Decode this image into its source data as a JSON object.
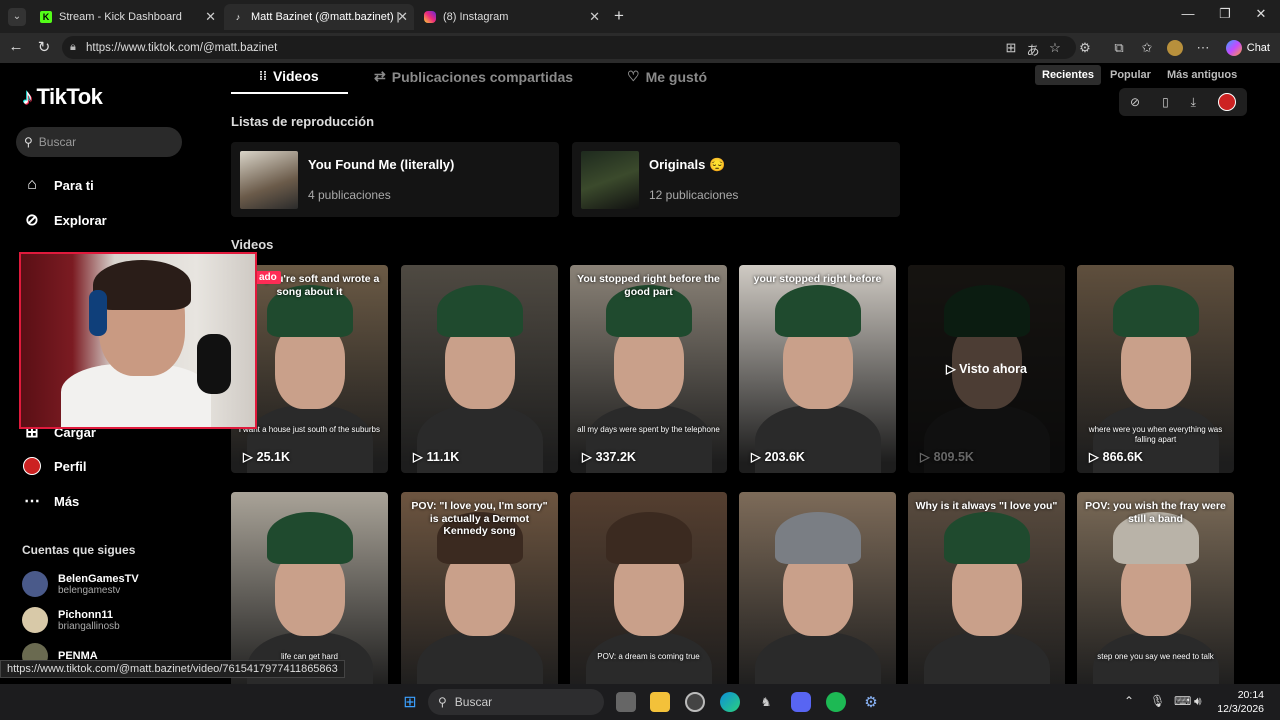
{
  "browser": {
    "tabs": [
      {
        "label": "Stream - Kick Dashboard",
        "icon": "kick-icon",
        "active": false
      },
      {
        "label": "Matt Bazinet (@matt.bazinet) | Tik",
        "icon": "tiktok-icon",
        "active": true
      },
      {
        "label": "(8) Instagram",
        "icon": "instagram-icon",
        "active": false
      }
    ],
    "url": "https://www.tiktok.com/@matt.bazinet",
    "chat_label": "Chat",
    "status_url": "https://www.tiktok.com/@matt.bazinet/video/7615417977411865863"
  },
  "sidebar": {
    "brand": "TikTok",
    "search_placeholder": "Buscar",
    "items": [
      {
        "label": "Para ti",
        "icon": "home-icon"
      },
      {
        "label": "Explorar",
        "icon": "compass-icon"
      },
      {
        "label": "Cargar",
        "icon": "upload-icon"
      },
      {
        "label": "Perfil",
        "icon": "profile-icon"
      },
      {
        "label": "Más",
        "icon": "more-icon"
      }
    ],
    "following_title": "Cuentas que sigues",
    "following": [
      {
        "name": "BelenGamesTV",
        "handle": "belengamestv"
      },
      {
        "name": "Pichonn11",
        "handle": "briangallinosb"
      },
      {
        "name": "PENMA",
        "handle": ""
      }
    ]
  },
  "profile_tabs": [
    {
      "label": "Videos",
      "icon": "grid-icon",
      "active": true
    },
    {
      "label": "Publicaciones compartidas",
      "icon": "repost-icon",
      "active": false
    },
    {
      "label": "Me gustó",
      "icon": "heart-icon",
      "active": false
    }
  ],
  "sort": {
    "options": [
      "Recientes",
      "Popular",
      "Más antiguos"
    ],
    "selected": "Recientes"
  },
  "playlists": {
    "title": "Listas de reproducción",
    "items": [
      {
        "title": "You Found Me (literally)",
        "count": "4 publicaciones"
      },
      {
        "title": "Originals 😔",
        "count": "12 publicaciones"
      }
    ]
  },
  "videos": {
    "title": "Videos",
    "watched_label": "Visto ahora",
    "pinned_label": "ado",
    "items": [
      {
        "caption": "pov: you're soft and wrote a song about it",
        "subtitle": "i want a house just south of the suburbs",
        "views": "25.1K",
        "hat": "#1f4a2e"
      },
      {
        "caption": "",
        "subtitle": "",
        "views": "11.1K",
        "hat": "#1f4a2e"
      },
      {
        "caption": "You stopped right before the good part",
        "subtitle": "all my days were spent by the telephone",
        "views": "337.2K",
        "hat": "#1f4a2e"
      },
      {
        "caption": "your stopped right before",
        "subtitle": "",
        "views": "203.6K",
        "hat": "#1f4a2e"
      },
      {
        "caption": "",
        "subtitle": "",
        "views": "809.5K",
        "hat": "#1f4a2e"
      },
      {
        "caption": "",
        "subtitle": "where were you when everything was falling apart",
        "views": "866.6K",
        "hat": "#1f4a2e"
      },
      {
        "caption": "",
        "subtitle": "life can get hard",
        "views": "",
        "hat": "#1f4a2e"
      },
      {
        "caption": "POV: \"I love you, I'm sorry\" is actually a Dermot Kennedy song",
        "subtitle": "",
        "views": "",
        "hat": "#3b2a20"
      },
      {
        "caption": "",
        "subtitle": "POV: a dream is coming true",
        "views": "",
        "hat": "#3b2a20"
      },
      {
        "caption": "",
        "subtitle": "",
        "views": "",
        "hat": "#7a7e84"
      },
      {
        "caption": "Why is it always \"I love you\"",
        "subtitle": "",
        "views": "",
        "hat": "#1f4a2e"
      },
      {
        "caption": "POV: you wish the fray were still a band",
        "subtitle": "step one you say we need to talk",
        "views": "",
        "hat": "#b9b3a8"
      }
    ]
  },
  "taskbar": {
    "search_placeholder": "Buscar",
    "time": "20:14",
    "date": "12/3/2026"
  }
}
